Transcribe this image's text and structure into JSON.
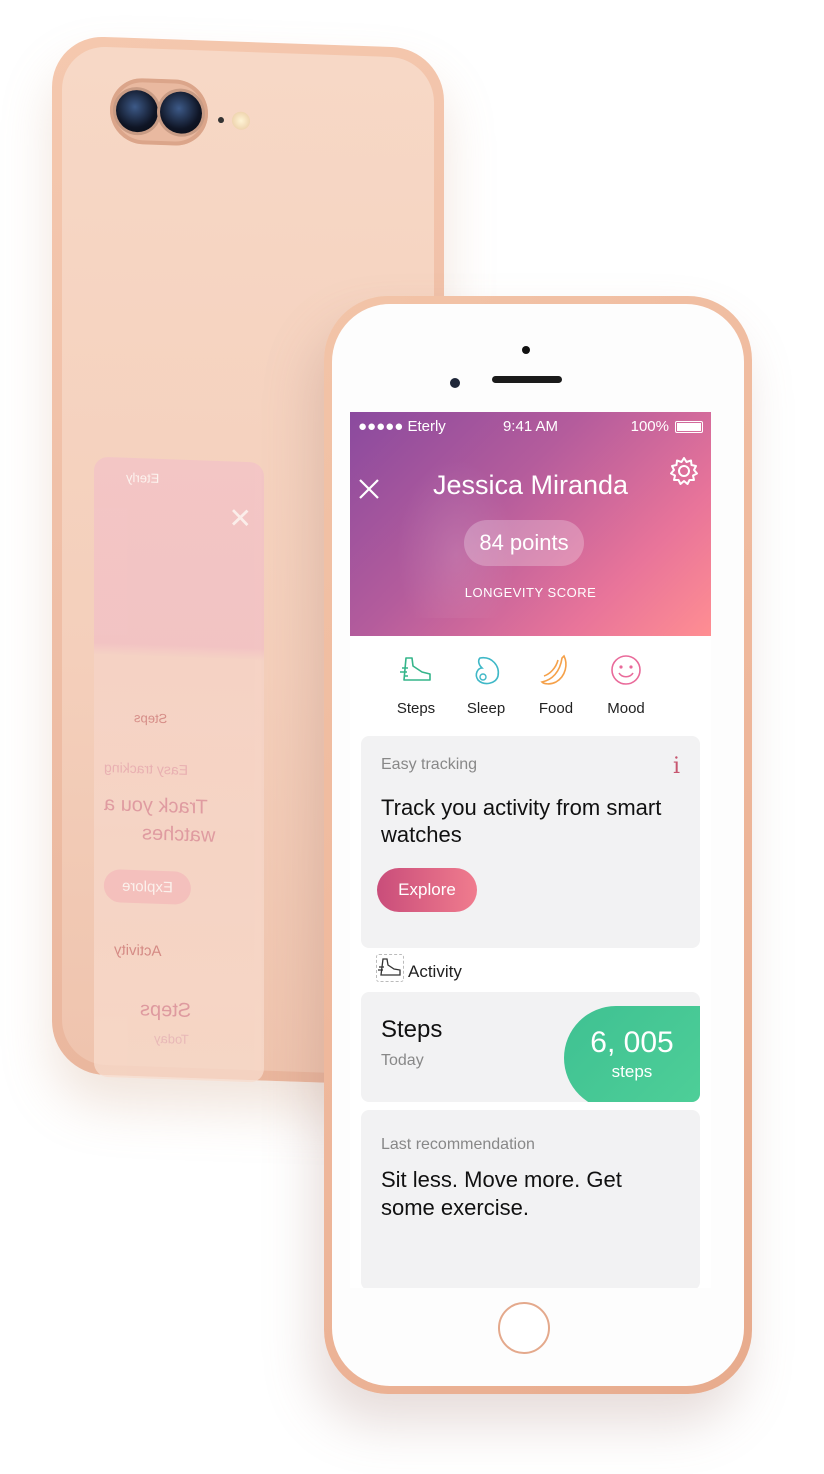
{
  "back_reflection": {
    "carrier": "Eterly",
    "steps": "Steps",
    "tracking": "Easy tracking",
    "title1": "Track you a",
    "title2": "watches",
    "explore": "Explore",
    "activity": "Activity",
    "steps_card": "Steps",
    "today": "Today"
  },
  "status": {
    "carrier": "●●●●● Eterly",
    "time": "9:41 AM",
    "battery": "100%"
  },
  "header": {
    "name": "Jessica Miranda",
    "points": "84 points",
    "score_label": "LONGEVITY SCORE"
  },
  "categories": [
    {
      "label": "Steps",
      "icon": "shoe-icon",
      "color": "#35b58a"
    },
    {
      "label": "Sleep",
      "icon": "sleep-icon",
      "color": "#3fb8c7"
    },
    {
      "label": "Food",
      "icon": "banana-icon",
      "color": "#f5a14a"
    },
    {
      "label": "Mood",
      "icon": "smiley-icon",
      "color": "#e96a9a"
    }
  ],
  "tracking_card": {
    "small": "Easy tracking",
    "info": "i",
    "title": "Track you activity from smart watches",
    "button": "Explore"
  },
  "activity": {
    "label": "Activity"
  },
  "steps_card": {
    "title": "Steps",
    "subtitle": "Today",
    "value": "6, 005",
    "unit": "steps"
  },
  "recommendation": {
    "small": "Last recommendation",
    "text": "Sit less. Move more. Get some exercise."
  },
  "colors": {
    "accent_pink": "#e8749a",
    "accent_green": "#4ecf98",
    "phone_gold": "#efb89c"
  }
}
